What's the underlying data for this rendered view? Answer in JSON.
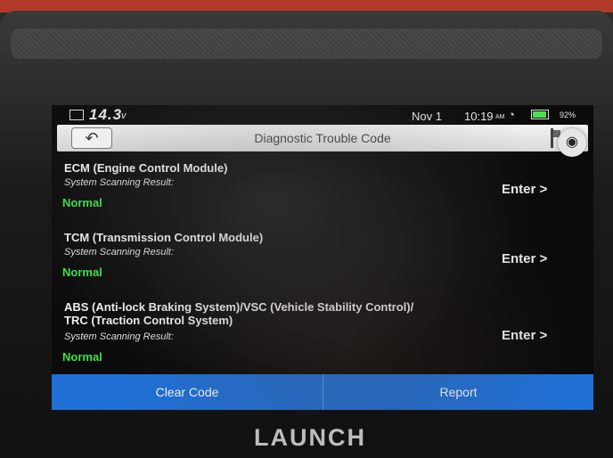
{
  "status_bar": {
    "voltage": "14.3",
    "voltage_unit": "v",
    "date": "Nov 1",
    "time": "10:19",
    "ampm": "AM",
    "battery_percent": "92%"
  },
  "header": {
    "title": "Diagnostic Trouble Code",
    "back_icon": "back-arrow-icon",
    "camera_icon": "camera-icon"
  },
  "systems": [
    {
      "name": "ECM (Engine Control Module)",
      "label": "System Scanning Result:",
      "result": "Normal",
      "enter": "Enter >"
    },
    {
      "name": "TCM (Transmission Control Module)",
      "label": "System Scanning Result:",
      "result": "Normal",
      "enter": "Enter >"
    },
    {
      "name_line1": "ABS (Anti-lock Braking System)/VSC (Vehicle Stability Control)/",
      "name_line2": "TRC (Traction Control System)",
      "label": "System Scanning Result:",
      "result": "Normal",
      "enter": "Enter >"
    }
  ],
  "actions": {
    "clear_code": "Clear Code",
    "report": "Report"
  },
  "brand": "LAUNCH",
  "colors": {
    "accent": "#1f6fd6",
    "normal_status": "#3fe04a",
    "device_trim": "#b23a2a"
  }
}
